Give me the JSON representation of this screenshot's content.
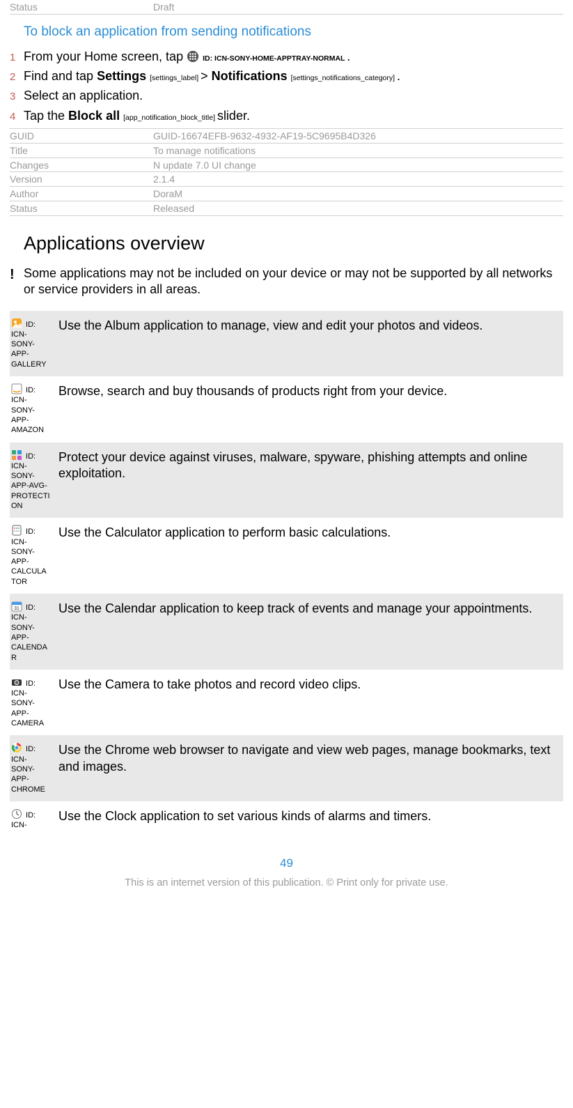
{
  "top_meta": {
    "key": "Status",
    "val": "Draft"
  },
  "block_heading": "To block an application from sending notifications",
  "steps": [
    {
      "before": "From your Home screen, tap ",
      "icon_id_label": " ID: ICN-SONY-HOME-APPTRAY-NORMAL ",
      "after": "."
    },
    {
      "plain_a": "Find and tap ",
      "bold_a": "Settings",
      "tiny_a": " [settings_label] ",
      "mid": "> ",
      "bold_b": "Notifications",
      "tiny_b": " [settings_notifications_category] ",
      "end": "."
    },
    {
      "plain": "Select an application."
    },
    {
      "plain_a": "Tap the ",
      "bold_a": "Block all",
      "tiny_a": " [app_notification_block_title] ",
      "plain_b": "slider."
    }
  ],
  "meta2": [
    {
      "k": "GUID",
      "v": "GUID-16674EFB-9632-4932-AF19-5C9695B4D326"
    },
    {
      "k": "Title",
      "v": "To manage notifications"
    },
    {
      "k": "Changes",
      "v": "N update 7.0 UI change"
    },
    {
      "k": "Version",
      "v": "2.1.4"
    },
    {
      "k": "Author",
      "v": "DoraM"
    },
    {
      "k": "Status",
      "v": "Released"
    }
  ],
  "apps_overview_heading": "Applications overview",
  "apps_note": "Some applications may not be included on your device or may not be supported by all networks or service providers in all areas.",
  "apps": [
    {
      "id_label": " ID: ICN-SONY-APP-GALLERY",
      "desc": "Use the Album application to manage, view and edit your photos and videos."
    },
    {
      "id_label": " ID: ICN-SONY-APP-AMAZON",
      "desc": "Browse, search and buy thousands of products right from your device."
    },
    {
      "id_label": " ID: ICN-SONY-APP-AVG-PROTECTION",
      "desc": "Protect your device against viruses, malware, spyware, phishing attempts and online exploitation."
    },
    {
      "id_label": " ID: ICN-SONY-APP-CALCULATOR",
      "desc": "Use the Calculator application to perform basic calculations."
    },
    {
      "id_label": " ID: ICN-SONY-APP-CALENDAR",
      "desc": "Use the Calendar application to keep track of events and manage your appointments."
    },
    {
      "id_label": " ID: ICN-SONY-APP-CAMERA",
      "desc": "Use the Camera to take photos and record video clips."
    },
    {
      "id_label": " ID: ICN-SONY-APP-CHROME",
      "desc": "Use the Chrome web browser to navigate and view web pages, manage bookmarks, text and images."
    },
    {
      "id_label": " ID: ICN-",
      "desc": "Use the Clock application to set various kinds of alarms and timers."
    }
  ],
  "page_number": "49",
  "footer": "This is an internet version of this publication. © Print only for private use."
}
